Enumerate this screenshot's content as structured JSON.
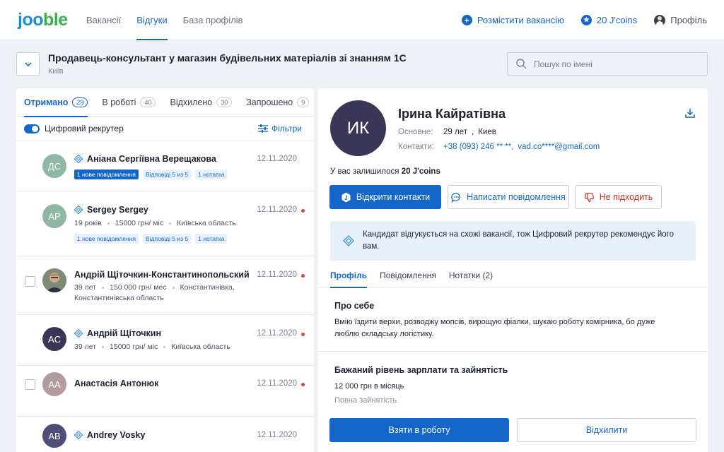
{
  "header": {
    "logo": {
      "part1": "joo",
      "part2": "ble"
    },
    "nav": [
      {
        "label": "Вакансії",
        "active": false
      },
      {
        "label": "Відгуки",
        "active": true
      },
      {
        "label": "База профілів",
        "active": false
      }
    ],
    "post_vacancy": "Розмістити вакансію",
    "coins": "20 J'coins",
    "profile": "Профіль"
  },
  "job": {
    "title": "Продавець-консультант у магазин будівельних матеріалів зі знанням 1С",
    "city": "Київ"
  },
  "search": {
    "placeholder": "Пошук по імені"
  },
  "tabs": [
    {
      "label": "Отримано",
      "count": "29",
      "active": true
    },
    {
      "label": "В роботі",
      "count": "40",
      "active": false
    },
    {
      "label": "Відхилено",
      "count": "30",
      "active": false
    },
    {
      "label": "Запрошено",
      "count": "9",
      "active": false
    }
  ],
  "filter_row": {
    "toggle_label": "Цифровий рекрутер",
    "toggle_on": true,
    "filters_label": "Фільтри"
  },
  "candidates": [
    {
      "initials": "ДС",
      "name": "Аніана Сергіївна Верещакова",
      "date": "12.11.2020",
      "verified": true,
      "unread": false,
      "meta": [],
      "badges": [
        "1 нове повідомлення",
        "Відповіді 5 из 5",
        "1 нотатка"
      ],
      "avatar_color": "#8fb7a3"
    },
    {
      "initials": "AP",
      "name": "Sergey Sergey",
      "date": "12.11.2020",
      "verified": true,
      "unread": true,
      "meta": [
        "19 років",
        "15000 грн/ міс",
        "Київська область"
      ],
      "badges": [
        "1 нове повідомлення",
        "Відповіді 5 из 5",
        "1 нотатка"
      ],
      "avatar_color": "#8fb7a3"
    },
    {
      "initials": "",
      "name": "Андрій Щіточкин-Константинопольский",
      "date": "12.11.2020",
      "verified": false,
      "unread": true,
      "meta": [
        "39 лет",
        "150 000 грн/ мес",
        "Константинівка,",
        "Константинівська область"
      ],
      "badges": [],
      "avatar_color": "#6f7a68"
    },
    {
      "initials": "AC",
      "name": "Андрій Щіточкин",
      "date": "12.11.2020",
      "verified": true,
      "unread": true,
      "meta": [
        "39 лет",
        "15000 грн/ міс",
        "Київська область"
      ],
      "badges": [],
      "avatar_color": "#3a3656"
    },
    {
      "initials": "AA",
      "name": "Анастасія Антонюк",
      "date": "12.11.2020",
      "verified": false,
      "unread": true,
      "meta": [],
      "badges": [],
      "avatar_color": "#b39a9f"
    },
    {
      "initials": "AB",
      "name": "Andrey Vosky",
      "date": "12.11.2020",
      "verified": true,
      "unread": false,
      "meta": [],
      "badges": [],
      "avatar_color": "#4f4d7a"
    }
  ],
  "profile": {
    "initials": "ИК",
    "name": "Ірина Кайратівна",
    "basic_label": "Основне:",
    "basic_age": "29 лет",
    "basic_city": "Киев",
    "contacts_label": "Контакти:",
    "phone": "+38 (093) 246 ** **,",
    "email": "vad.co****@gmail.com",
    "coins_text": "У вас залишилося",
    "coins_value": "20 J'coins",
    "btn_open_contacts": "Відкрити контакти",
    "btn_message": "Написати повідомлення",
    "btn_reject_small": "Не підходить",
    "info_text": "Кандидат відгукується на схожі вакансії, тож Цифровий рекрутер рекомендує його вам.",
    "tabs": [
      {
        "label": "Профіль",
        "active": true
      },
      {
        "label": "Повідомлення",
        "active": false
      },
      {
        "label": "Нотатки (2)",
        "active": false
      }
    ],
    "about_title": "Про себе",
    "about_text": "Вмію їздити верхи, розводжу мопсів, вирощую фіалки, шукаю роботу комірника, бо дуже люблю складську логістику.",
    "salary_title": "Бажаний рівень зарплати та зайнятість",
    "salary_value": "12 000 грн в місяць",
    "employment": "Повна зайнятість",
    "btn_hire": "Взяти в роботу",
    "btn_decline": "Відхилити"
  },
  "colors": {
    "accent": "#1467c8",
    "danger": "#e0413a",
    "logo_blue": "#1a8ed6",
    "logo_green": "#33b34a"
  }
}
